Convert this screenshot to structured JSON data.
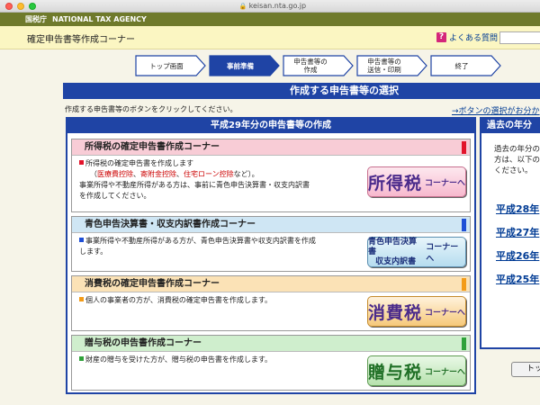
{
  "browser": {
    "url": "keisan.nta.go.jp",
    "lock_icon": "lock-icon"
  },
  "agency": {
    "kanji": "国税庁",
    "name": "NATIONAL TAX AGENCY"
  },
  "header": {
    "title": "確定申告書等作成コーナー",
    "faq_label": "よくある質問",
    "faq_icon": "question-icon"
  },
  "steps": [
    {
      "line1": "トップ画面",
      "line2": ""
    },
    {
      "line1": "事前準備",
      "line2": ""
    },
    {
      "line1": "申告書等の",
      "line2": "作成"
    },
    {
      "line1": "申告書等の",
      "line2": "送信・印刷"
    },
    {
      "line1": "終了",
      "line2": ""
    }
  ],
  "page_title": "作成する申告書等の選択",
  "instruction": "作成する申告書等のボタンをクリックしてください。",
  "instruction_link": "→ボタンの選択がお分か",
  "main_panel": {
    "title": "平成29年分の申告書等の作成",
    "sections": [
      {
        "title": "所得税の確定申告書作成コーナー",
        "line1": "所得税の確定申告書を作成します",
        "paren_open": "（",
        "deductions": [
          "医療費控除",
          "寄附金控除",
          "住宅ローン控除"
        ],
        "sep": "、",
        "paren_close": "など）。",
        "line3": "事業所得や不動産所得がある方は、事前に青色申告決算書・収支内訳書",
        "line4": "を作成してください。",
        "button_big": "所得税",
        "button_small": "コーナーへ"
      },
      {
        "title": "青色申告決算書・収支内訳書作成コーナー",
        "line1": "事業所得や不動産所得がある方が、青色申告決算書や収支内訳書を作成",
        "line2": "します。",
        "button_line1": "青色申告決算書",
        "button_line2": "収支内訳書",
        "button_small": "コーナーへ"
      },
      {
        "title": "消費税の確定申告書作成コーナー",
        "line1": "個人の事業者の方が、消費税の確定申告書を作成します。",
        "button_big": "消費税",
        "button_small": "コーナーへ"
      },
      {
        "title": "贈与税の申告書作成コーナー",
        "line1": "財産の贈与を受けた方が、贈与税の申告書を作成します。",
        "button_big": "贈与税",
        "button_small": "コーナーへ"
      }
    ]
  },
  "past_panel": {
    "title": "過去の年分",
    "text": [
      "過去の年分の",
      "方は、以下の",
      "ください。"
    ],
    "links": [
      "平成28年",
      "平成27年",
      "平成26年",
      "平成25年"
    ]
  },
  "top_button": "トッ",
  "colors": {
    "nta_green": "#6f7a2b",
    "nav_blue": "#1f44a5",
    "income_pink": "#f8ccd6",
    "blue_section": "#cfe6f4",
    "consumption_orange": "#fbe2b6",
    "gift_green": "#cfeecd"
  }
}
